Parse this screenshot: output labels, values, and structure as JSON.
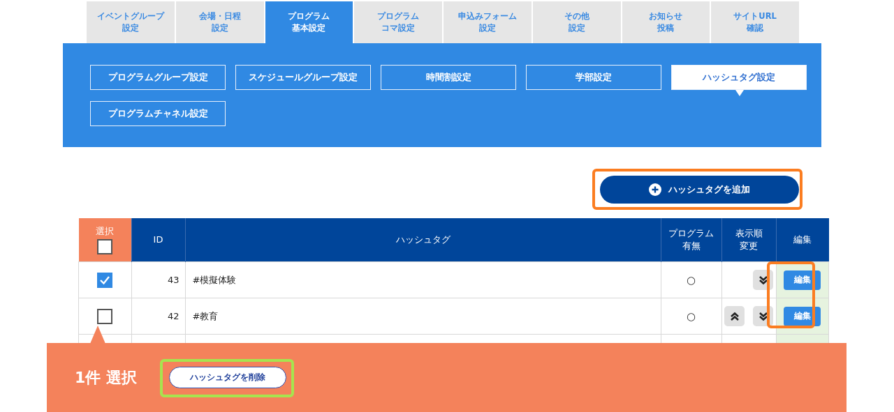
{
  "tabs": [
    {
      "label": [
        "イベントグループ",
        "設定"
      ],
      "selected": false
    },
    {
      "label": [
        "会場・日程",
        "設定"
      ],
      "selected": false
    },
    {
      "label": [
        "プログラム",
        "基本設定"
      ],
      "selected": true
    },
    {
      "label": [
        "プログラム",
        "コマ設定"
      ],
      "selected": false
    },
    {
      "label": [
        "申込みフォーム",
        "設定"
      ],
      "selected": false
    },
    {
      "label": [
        "その他",
        "設定"
      ],
      "selected": false
    },
    {
      "label": [
        "お知らせ",
        "投稿"
      ],
      "selected": false
    },
    {
      "label": [
        "サイトURL",
        "確認"
      ],
      "selected": false
    }
  ],
  "subtabs": [
    {
      "label": "プログラムグループ設定",
      "selected": false
    },
    {
      "label": "スケジュールグループ設定",
      "selected": false
    },
    {
      "label": "時間割設定",
      "selected": false
    },
    {
      "label": "学部設定",
      "selected": false
    },
    {
      "label": "ハッシュタグ設定",
      "selected": true
    },
    {
      "label": "プログラムチャネル設定",
      "selected": false
    }
  ],
  "add_button": "ハッシュタグを追加",
  "table": {
    "columns": [
      [
        "選択"
      ],
      [
        "ID"
      ],
      [
        "ハッシュタグ"
      ],
      [
        "プログラム",
        "有無"
      ],
      [
        "表示順",
        "変更"
      ],
      [
        "編集"
      ]
    ],
    "select_all_checked": false,
    "rows": [
      {
        "checked": true,
        "id": "43",
        "hashtag": "#模擬体験",
        "program": "○",
        "can_up": false,
        "can_down": true,
        "edit": "編集"
      },
      {
        "checked": false,
        "id": "42",
        "hashtag": "#教育",
        "program": "○",
        "can_up": true,
        "can_down": true,
        "edit": "編集"
      }
    ]
  },
  "selection_bar": {
    "count": "1件 選択",
    "delete_button": "ハッシュタグを削除"
  }
}
